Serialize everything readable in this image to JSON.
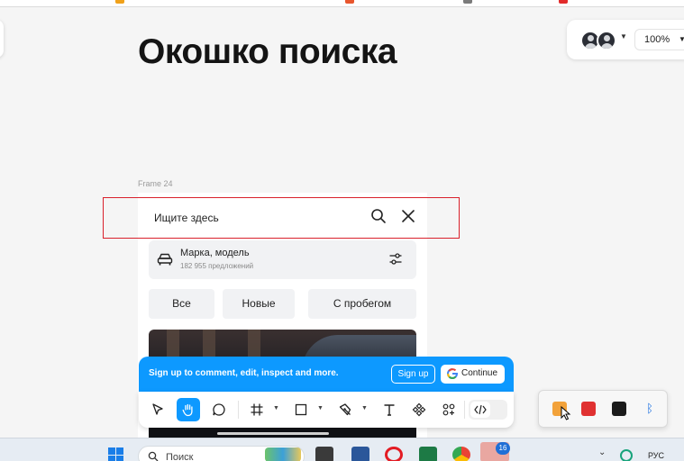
{
  "canvas": {
    "title": "Окошко поиска",
    "frame_label": "Frame 24"
  },
  "top_right": {
    "zoom": "100%"
  },
  "frame": {
    "search_placeholder": "Ищите здесь",
    "brand_card": {
      "title": "Марка, модель",
      "subtitle": "182 955 предложений"
    },
    "chips": [
      "Все",
      "Новые",
      "С пробегом"
    ]
  },
  "signup_banner": {
    "text": "Sign up to comment, edit, inspect and more.",
    "signup_label": "Sign up",
    "continue_label": "Continue"
  },
  "toolbar": {
    "tools": [
      "move",
      "hand",
      "comment",
      "frame",
      "shape",
      "pen",
      "text",
      "components",
      "plugins",
      "dev-mode"
    ],
    "active_tool": "hand"
  },
  "colors": {
    "accent": "#0d99ff",
    "highlight": "#d9202b"
  },
  "taskbar": {
    "search_label": "Поиск",
    "notification_count": "16",
    "language": "РУС"
  }
}
